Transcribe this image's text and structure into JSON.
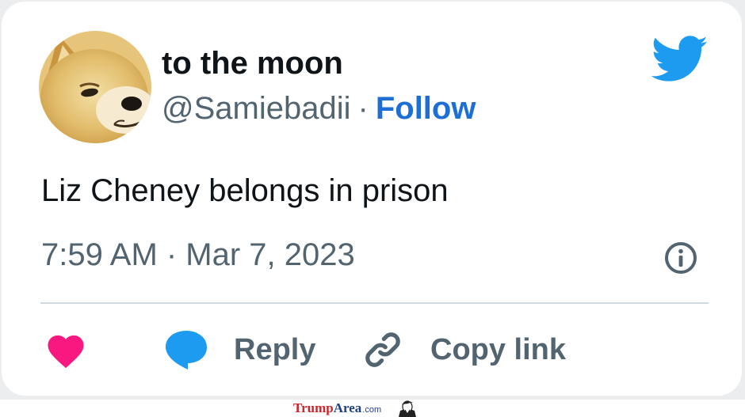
{
  "tweet": {
    "display_name": "to the moon",
    "handle": "@Samiebadii",
    "separator": "·",
    "follow_label": "Follow",
    "text": "Liz Cheney belongs in prison",
    "timestamp": "7:59 AM · Mar 7, 2023"
  },
  "actions": {
    "like_icon": "heart-icon",
    "reply_label": "Reply",
    "reply_icon": "speech-bubble-icon",
    "copy_link_label": "Copy link",
    "copy_link_icon": "link-icon"
  },
  "icons": {
    "avatar": "doge-avatar",
    "brand": "twitter-bird-icon",
    "info": "info-icon"
  },
  "watermark": {
    "part1": "Trump",
    "part2": "Area",
    "part3": ".com"
  },
  "colors": {
    "text_primary": "#0f1419",
    "text_secondary": "#536471",
    "follow": "#1d6fd6",
    "twitter_blue": "#1d9bf0",
    "like": "#f91880",
    "divider": "#cfd9de",
    "frame_border": "#ebedef"
  }
}
